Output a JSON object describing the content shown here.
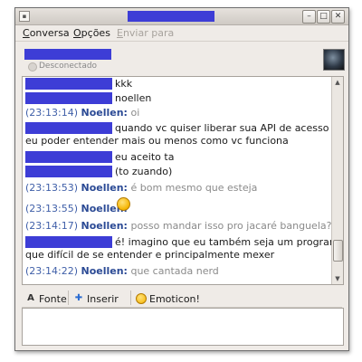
{
  "window": {
    "title_redacted": true,
    "icons": {
      "app": "app-icon",
      "minimize": "minimize-icon",
      "maximize": "maximize-icon",
      "close": "close-icon"
    }
  },
  "menubar": [
    {
      "label": "Conversa",
      "underline": "C",
      "enabled": true
    },
    {
      "label": "Opções",
      "underline": "O",
      "enabled": true
    },
    {
      "label": "Enviar para",
      "underline": "E",
      "enabled": false
    }
  ],
  "contact": {
    "name_redacted": true,
    "status": "Desconectado"
  },
  "colors": {
    "redaction": "#3d3dd6",
    "timestamp": "#3f5fa8",
    "nick": "#2b4a95",
    "system": "#8a8a8a"
  },
  "messages": [
    {
      "ts": "",
      "sender": "",
      "redacted_sender": true,
      "text": "kkk"
    },
    {
      "ts": "",
      "sender": "",
      "redacted_sender": true,
      "text": "noellen"
    },
    {
      "ts": "(23:13:14)",
      "sender": "Noellen:",
      "text": "oi"
    },
    {
      "ts": "",
      "sender": "",
      "redacted_sender": true,
      "text": "quando vc quiser liberar sua API de acesso para"
    },
    {
      "ts": "",
      "sender": "",
      "text": "eu poder entender mais ou menos como vc funciona"
    },
    {
      "ts": "",
      "sender": "",
      "redacted_sender": true,
      "text": "eu aceito ta"
    },
    {
      "ts": "",
      "sender": "",
      "redacted_sender": true,
      "text": "(to zuando)"
    },
    {
      "ts": "(23:13:53)",
      "sender": "Noellen:",
      "text": "é bom mesmo que esteja"
    },
    {
      "ts": "(23:13:55)",
      "sender": "Noellen:",
      "text": "",
      "emoticon": "smiley-tongue-icon"
    },
    {
      "ts": "(23:14:17)",
      "sender": "Noellen:",
      "text": "posso mandar isso pro jacaré banguela?"
    },
    {
      "ts": "",
      "sender": "",
      "redacted_sender": true,
      "text": "é! imagino que eu também seja um programa"
    },
    {
      "ts": "",
      "sender": "",
      "text": "que difícil de se entender e principalmente mexer"
    },
    {
      "ts": "(23:14:22)",
      "sender": "Noellen:",
      "text": "que cantada nerd"
    }
  ],
  "toolbar": {
    "font_label": "Fonte",
    "font_icon": "font-icon",
    "insert_label": "Inserir",
    "insert_icon": "insert-icon",
    "emoticon_label": "Emoticon!",
    "emoticon_icon": "smiley-icon"
  },
  "input": {
    "value": ""
  }
}
